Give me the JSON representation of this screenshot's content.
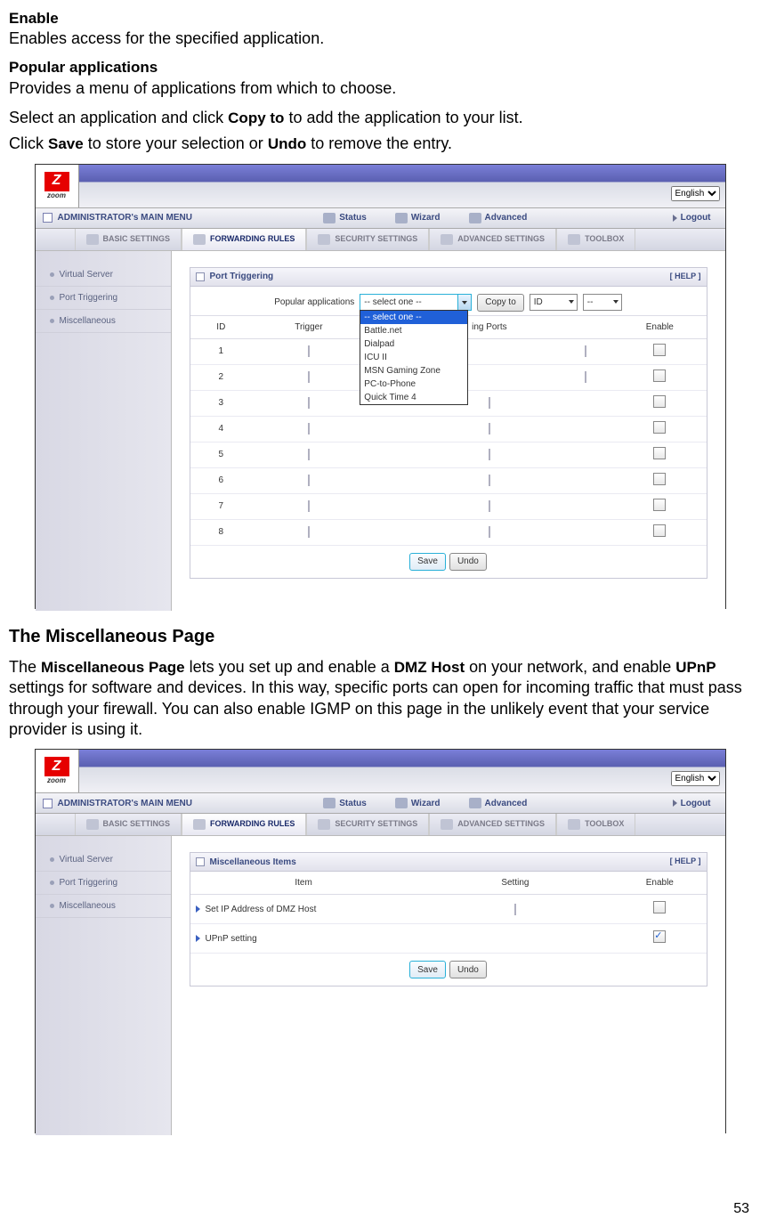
{
  "page_number": "53",
  "doc": {
    "enable_term": "Enable",
    "enable_desc": "Enables access for the specified application.",
    "popular_term": "Popular applications",
    "popular_desc": "Provides a menu of applications from which to choose.",
    "select_line_pre": "Select an application and click ",
    "copy_to_bold": "Copy to",
    "select_line_post": " to add the application to your list.",
    "click_pre": "Click ",
    "save_bold": "Save",
    "click_mid": " to store your selection or ",
    "undo_bold": "Undo",
    "click_post": " to remove the entry.",
    "heading_misc": "The Miscellaneous Page",
    "misc_p1_pre": "The ",
    "misc_page_bold": "Miscellaneous Page",
    "misc_p1_mid1": " lets you set up and enable a ",
    "dmz_bold": "DMZ Host",
    "misc_p1_mid2": " on your network, and enable ",
    "upnp_bold": "UPnP",
    "misc_p1_post": " settings for software and devices. In this way, specific ports can open for incoming traffic that must pass through your firewall. You can also enable IGMP on this page in the unlikely event that your service provider is using it."
  },
  "ui": {
    "logo_text": "zoom",
    "lang": "English",
    "menu_title": "ADMINISTRATOR's MAIN MENU",
    "menu": {
      "status": "Status",
      "wizard": "Wizard",
      "advanced": "Advanced",
      "logout": "Logout"
    },
    "tabs": {
      "basic": "BASIC SETTINGS",
      "forwarding": "FORWARDING RULES",
      "security": "SECURITY SETTINGS",
      "advanced": "ADVANCED SETTINGS",
      "toolbox": "TOOLBOX"
    },
    "sidebar": {
      "vserver": "Virtual Server",
      "ptrigger": "Port Triggering",
      "misc": "Miscellaneous"
    },
    "help": "[ HELP ]",
    "fig1": {
      "panel_title": "Port Triggering",
      "popular_label": "Popular applications",
      "sel_placeholder": "-- select one --",
      "copy_btn": "Copy to",
      "id_sel": "ID",
      "dropdown": [
        "-- select one --",
        "Battle.net",
        "Dialpad",
        "ICU II",
        "MSN Gaming Zone",
        "PC-to-Phone",
        "Quick Time 4"
      ],
      "cols": {
        "id": "ID",
        "trigger": "Trigger",
        "inc": "ing Ports",
        "enable": "Enable"
      },
      "rows": [
        "1",
        "2",
        "3",
        "4",
        "5",
        "6",
        "7",
        "8"
      ],
      "save": "Save",
      "undo": "Undo"
    },
    "fig2": {
      "panel_title": "Miscellaneous Items",
      "cols": {
        "item": "Item",
        "setting": "Setting",
        "enable": "Enable"
      },
      "row1": "Set IP Address of DMZ Host",
      "row2": "UPnP setting",
      "save": "Save",
      "undo": "Undo"
    }
  }
}
